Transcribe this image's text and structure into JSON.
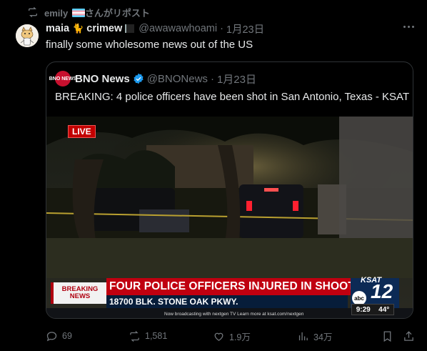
{
  "repost": {
    "user": "emily",
    "suffix": "さんがリポスト"
  },
  "tweet": {
    "display_name": "maia",
    "name_emoji": "🐈",
    "name_rest": "crimew",
    "handle": "@awawawhoami",
    "separator": "·",
    "date": "1月23日",
    "text": "finally some wholesome news out of the US"
  },
  "quote": {
    "avatar_text": "BNO NEWS",
    "display_name": "BNO News",
    "handle": "@BNONews",
    "separator": "·",
    "date": "1月23日",
    "text": "BREAKING: 4 police officers have been shot in San Antonio, Texas - KSAT",
    "media": {
      "live": "LIVE",
      "breaking": "BREAKING NEWS",
      "headline": "FOUR POLICE OFFICERS INJURED IN SHOOTING",
      "subline": "18700 BLK. STONE OAK PKWY.",
      "station_small": "KSAT",
      "station_big": "12",
      "network": "abc",
      "time": "9:29",
      "temp": "44°",
      "ticker": "Now broadcasting with nextgen TV   Learn more at ksat.com/nextgen"
    }
  },
  "actions": {
    "replies": "69",
    "reposts": "1,581",
    "likes": "1.9万",
    "views": "34万"
  },
  "colors": {
    "background": "#000000",
    "muted": "#71767b",
    "text": "#e7e9ea",
    "border": "#2f3336",
    "verified": "#1d9bf0"
  }
}
